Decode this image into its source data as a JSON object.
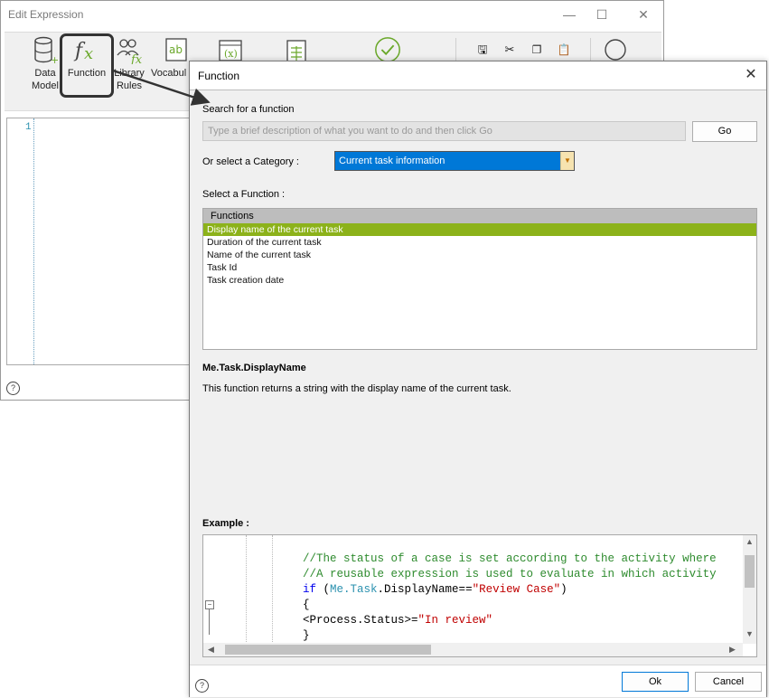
{
  "edit_expression": {
    "title": "Edit Expression",
    "ribbon": [
      {
        "label1": "Data",
        "label2": "Model",
        "icon": "database-icon"
      },
      {
        "label1": "Function",
        "label2": "",
        "icon": "fx-icon"
      },
      {
        "label1": "Library",
        "label2": "Rules",
        "icon": "library-rules-icon"
      },
      {
        "label1": "Vocabul",
        "label2": "",
        "icon": "vocabulary-icon"
      }
    ],
    "editor_line_number": "1"
  },
  "function_dialog": {
    "title": "Function",
    "search_label": "Search for a function",
    "search_placeholder": "Type a brief description of what you want to do and then click Go",
    "go_label": "Go",
    "category_label": "Or select a Category :",
    "category_value": "Current task information",
    "select_function_label": "Select a Function :",
    "functions_header": "Functions",
    "functions": [
      "Display name of the current task",
      "Duration of the current task",
      "Name of the current task",
      "Task Id",
      "Task creation date"
    ],
    "selected_function_index": 0,
    "function_name": "Me.Task.DisplayName",
    "function_description": "This function returns a string with the display name of the current task.",
    "example_label": "Example :",
    "example_code": {
      "line1": "//The status of a case is set according to the activity where",
      "line2": "//A reusable expression is used to evaluate in which activity",
      "if_kw": "if",
      "paren_open": " (",
      "member": "Me.Task",
      "dot_display": ".DisplayName==",
      "string_review": "\"Review Case\"",
      "paren_close": ")",
      "brace_open": "{",
      "status_left": "<Process.Status>=",
      "string_in_review": "\"In review\"",
      "brace_close": "}"
    },
    "ok_label": "Ok",
    "cancel_label": "Cancel"
  }
}
